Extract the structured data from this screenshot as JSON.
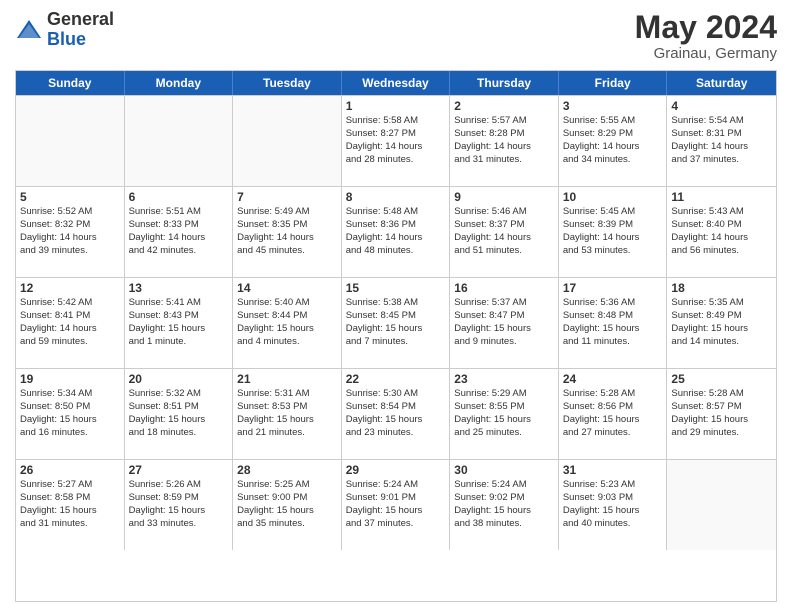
{
  "header": {
    "logo_general": "General",
    "logo_blue": "Blue",
    "month_year": "May 2024",
    "location": "Grainau, Germany"
  },
  "weekdays": [
    "Sunday",
    "Monday",
    "Tuesday",
    "Wednesday",
    "Thursday",
    "Friday",
    "Saturday"
  ],
  "rows": [
    [
      {
        "day": "",
        "info": ""
      },
      {
        "day": "",
        "info": ""
      },
      {
        "day": "",
        "info": ""
      },
      {
        "day": "1",
        "info": "Sunrise: 5:58 AM\nSunset: 8:27 PM\nDaylight: 14 hours\nand 28 minutes."
      },
      {
        "day": "2",
        "info": "Sunrise: 5:57 AM\nSunset: 8:28 PM\nDaylight: 14 hours\nand 31 minutes."
      },
      {
        "day": "3",
        "info": "Sunrise: 5:55 AM\nSunset: 8:29 PM\nDaylight: 14 hours\nand 34 minutes."
      },
      {
        "day": "4",
        "info": "Sunrise: 5:54 AM\nSunset: 8:31 PM\nDaylight: 14 hours\nand 37 minutes."
      }
    ],
    [
      {
        "day": "5",
        "info": "Sunrise: 5:52 AM\nSunset: 8:32 PM\nDaylight: 14 hours\nand 39 minutes."
      },
      {
        "day": "6",
        "info": "Sunrise: 5:51 AM\nSunset: 8:33 PM\nDaylight: 14 hours\nand 42 minutes."
      },
      {
        "day": "7",
        "info": "Sunrise: 5:49 AM\nSunset: 8:35 PM\nDaylight: 14 hours\nand 45 minutes."
      },
      {
        "day": "8",
        "info": "Sunrise: 5:48 AM\nSunset: 8:36 PM\nDaylight: 14 hours\nand 48 minutes."
      },
      {
        "day": "9",
        "info": "Sunrise: 5:46 AM\nSunset: 8:37 PM\nDaylight: 14 hours\nand 51 minutes."
      },
      {
        "day": "10",
        "info": "Sunrise: 5:45 AM\nSunset: 8:39 PM\nDaylight: 14 hours\nand 53 minutes."
      },
      {
        "day": "11",
        "info": "Sunrise: 5:43 AM\nSunset: 8:40 PM\nDaylight: 14 hours\nand 56 minutes."
      }
    ],
    [
      {
        "day": "12",
        "info": "Sunrise: 5:42 AM\nSunset: 8:41 PM\nDaylight: 14 hours\nand 59 minutes."
      },
      {
        "day": "13",
        "info": "Sunrise: 5:41 AM\nSunset: 8:43 PM\nDaylight: 15 hours\nand 1 minute."
      },
      {
        "day": "14",
        "info": "Sunrise: 5:40 AM\nSunset: 8:44 PM\nDaylight: 15 hours\nand 4 minutes."
      },
      {
        "day": "15",
        "info": "Sunrise: 5:38 AM\nSunset: 8:45 PM\nDaylight: 15 hours\nand 7 minutes."
      },
      {
        "day": "16",
        "info": "Sunrise: 5:37 AM\nSunset: 8:47 PM\nDaylight: 15 hours\nand 9 minutes."
      },
      {
        "day": "17",
        "info": "Sunrise: 5:36 AM\nSunset: 8:48 PM\nDaylight: 15 hours\nand 11 minutes."
      },
      {
        "day": "18",
        "info": "Sunrise: 5:35 AM\nSunset: 8:49 PM\nDaylight: 15 hours\nand 14 minutes."
      }
    ],
    [
      {
        "day": "19",
        "info": "Sunrise: 5:34 AM\nSunset: 8:50 PM\nDaylight: 15 hours\nand 16 minutes."
      },
      {
        "day": "20",
        "info": "Sunrise: 5:32 AM\nSunset: 8:51 PM\nDaylight: 15 hours\nand 18 minutes."
      },
      {
        "day": "21",
        "info": "Sunrise: 5:31 AM\nSunset: 8:53 PM\nDaylight: 15 hours\nand 21 minutes."
      },
      {
        "day": "22",
        "info": "Sunrise: 5:30 AM\nSunset: 8:54 PM\nDaylight: 15 hours\nand 23 minutes."
      },
      {
        "day": "23",
        "info": "Sunrise: 5:29 AM\nSunset: 8:55 PM\nDaylight: 15 hours\nand 25 minutes."
      },
      {
        "day": "24",
        "info": "Sunrise: 5:28 AM\nSunset: 8:56 PM\nDaylight: 15 hours\nand 27 minutes."
      },
      {
        "day": "25",
        "info": "Sunrise: 5:28 AM\nSunset: 8:57 PM\nDaylight: 15 hours\nand 29 minutes."
      }
    ],
    [
      {
        "day": "26",
        "info": "Sunrise: 5:27 AM\nSunset: 8:58 PM\nDaylight: 15 hours\nand 31 minutes."
      },
      {
        "day": "27",
        "info": "Sunrise: 5:26 AM\nSunset: 8:59 PM\nDaylight: 15 hours\nand 33 minutes."
      },
      {
        "day": "28",
        "info": "Sunrise: 5:25 AM\nSunset: 9:00 PM\nDaylight: 15 hours\nand 35 minutes."
      },
      {
        "day": "29",
        "info": "Sunrise: 5:24 AM\nSunset: 9:01 PM\nDaylight: 15 hours\nand 37 minutes."
      },
      {
        "day": "30",
        "info": "Sunrise: 5:24 AM\nSunset: 9:02 PM\nDaylight: 15 hours\nand 38 minutes."
      },
      {
        "day": "31",
        "info": "Sunrise: 5:23 AM\nSunset: 9:03 PM\nDaylight: 15 hours\nand 40 minutes."
      },
      {
        "day": "",
        "info": ""
      }
    ]
  ]
}
